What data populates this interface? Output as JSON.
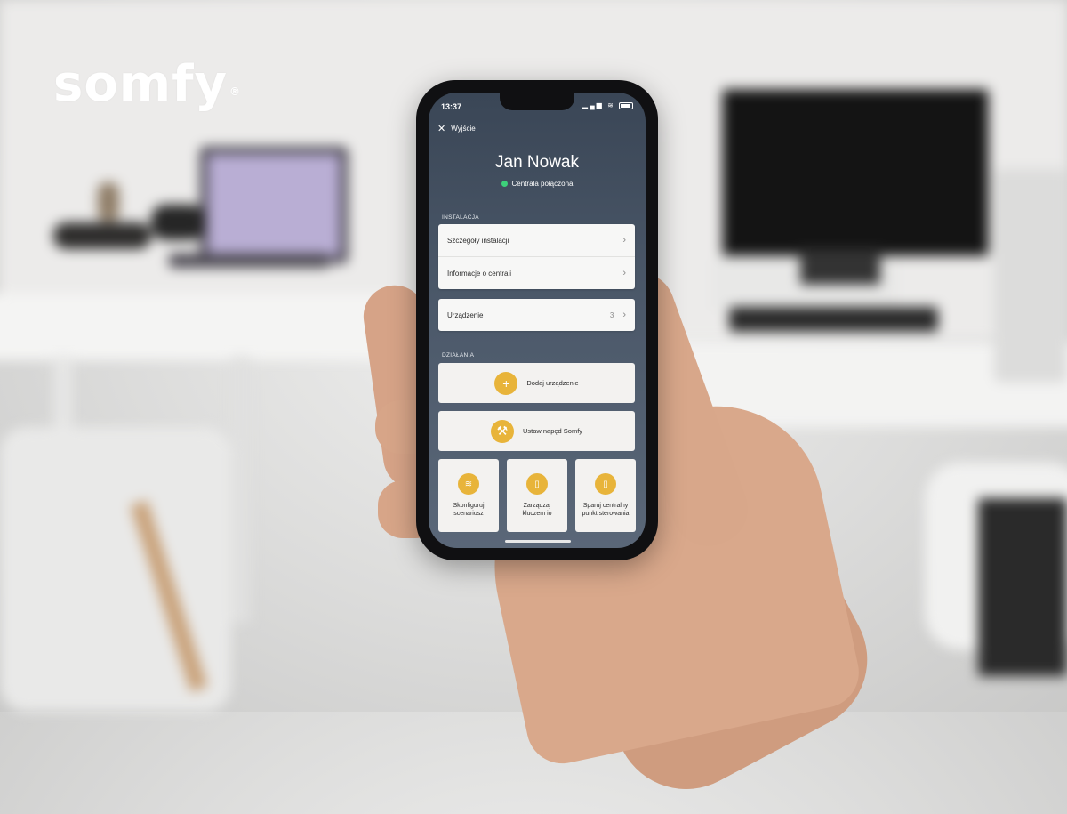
{
  "brand": {
    "logo_text": "somfy",
    "registered": "®"
  },
  "status_bar": {
    "time": "13:37",
    "signal": "▂▄▆",
    "wifi": "≋"
  },
  "header": {
    "exit_icon": "close-icon",
    "exit_label": "Wyjście",
    "user_name": "Jan Nowak",
    "connection_status": "Centrala połączona",
    "connection_color": "#3dd07a"
  },
  "installation": {
    "section_title": "INSTALACJA",
    "items": [
      {
        "label": "Szczegóły instalacji"
      },
      {
        "label": "Informacje o centrali"
      }
    ],
    "devices": {
      "label": "Urządzenie",
      "count": "3"
    }
  },
  "actions": {
    "section_title": "DZIAŁANIA",
    "add_device": {
      "label": "Dodaj urządzenie",
      "icon": "plus-icon"
    },
    "set_drive": {
      "label": "Ustaw napęd Somfy",
      "icon": "wrench-icon"
    },
    "tiles": [
      {
        "label_line1": "Skonfiguruj",
        "label_line2": "scenariusz",
        "icon": "wifi-icon"
      },
      {
        "label_line1": "Zarządzaj",
        "label_line2": "kluczem io",
        "icon": "key-icon"
      },
      {
        "label_line1": "Sparuj centralny",
        "label_line2": "punkt sterowania",
        "icon": "remote-icon"
      }
    ]
  },
  "colors": {
    "accent": "#e8b43a",
    "screen_bg": "#3a4656"
  }
}
